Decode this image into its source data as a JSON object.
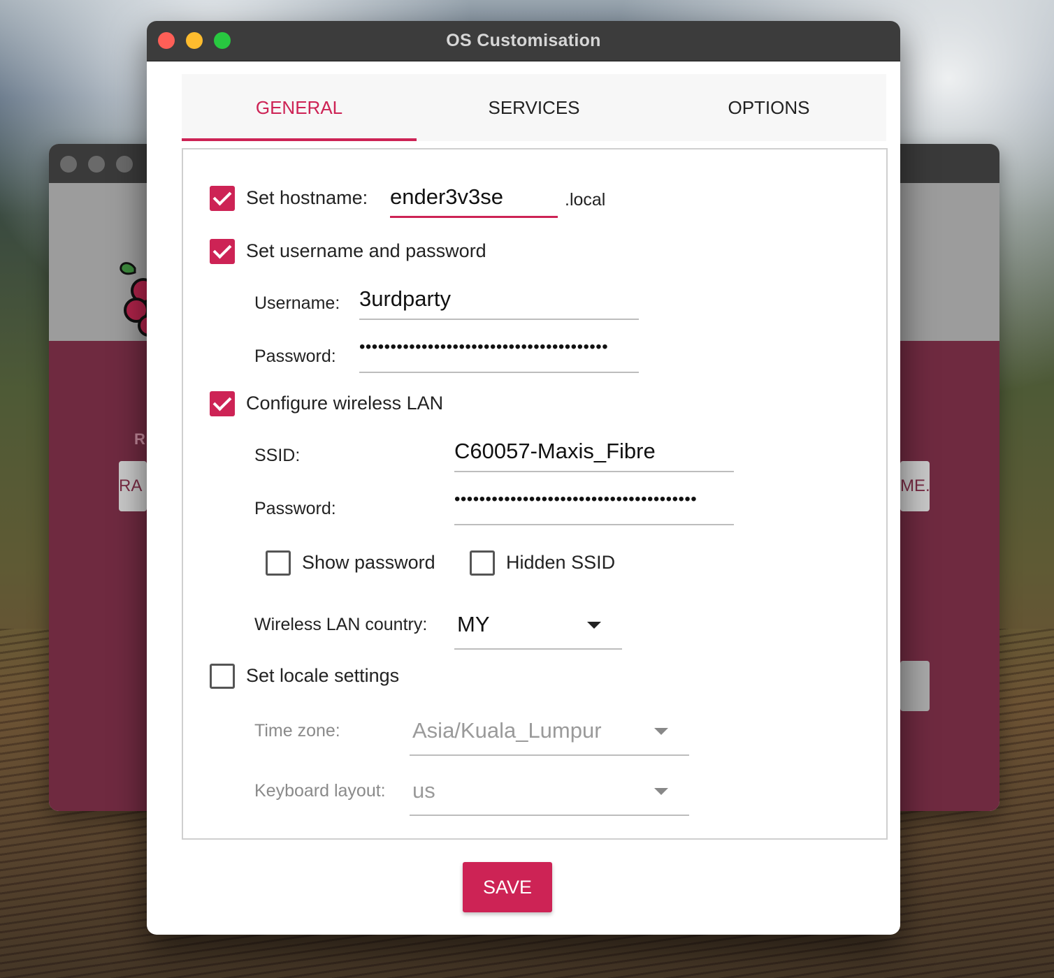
{
  "window": {
    "title": "OS Customisation"
  },
  "background_window": {
    "label_fragment": "R",
    "left_button_fragment": "RA",
    "right_button_fragment": "ME.."
  },
  "tabs": [
    {
      "label": "GENERAL",
      "active": true
    },
    {
      "label": "SERVICES",
      "active": false
    },
    {
      "label": "OPTIONS",
      "active": false
    }
  ],
  "general": {
    "hostname": {
      "label": "Set hostname:",
      "checked": true,
      "value": "ender3v3se",
      "suffix": ".local"
    },
    "user": {
      "label": "Set username and password",
      "checked": true,
      "username_label": "Username:",
      "username_value": "3urdparty",
      "password_label": "Password:",
      "password_value": "••••••••••••••••••••••••••••••••••••••••"
    },
    "wifi": {
      "label": "Configure wireless LAN",
      "checked": true,
      "ssid_label": "SSID:",
      "ssid_value": "C60057-Maxis_Fibre",
      "password_label": "Password:",
      "password_value": "•••••••••••••••••••••••••••••••••••••••",
      "show_password_label": "Show password",
      "show_password_checked": false,
      "hidden_ssid_label": "Hidden SSID",
      "hidden_ssid_checked": false,
      "country_label": "Wireless LAN country:",
      "country_value": "MY"
    },
    "locale": {
      "label": "Set locale settings",
      "checked": false,
      "timezone_label": "Time zone:",
      "timezone_value": "Asia/Kuala_Lumpur",
      "keyboard_label": "Keyboard layout:",
      "keyboard_value": "us"
    }
  },
  "save_label": "SAVE",
  "colors": {
    "accent": "#cd2355",
    "titlebar": "#3c3c3c"
  }
}
